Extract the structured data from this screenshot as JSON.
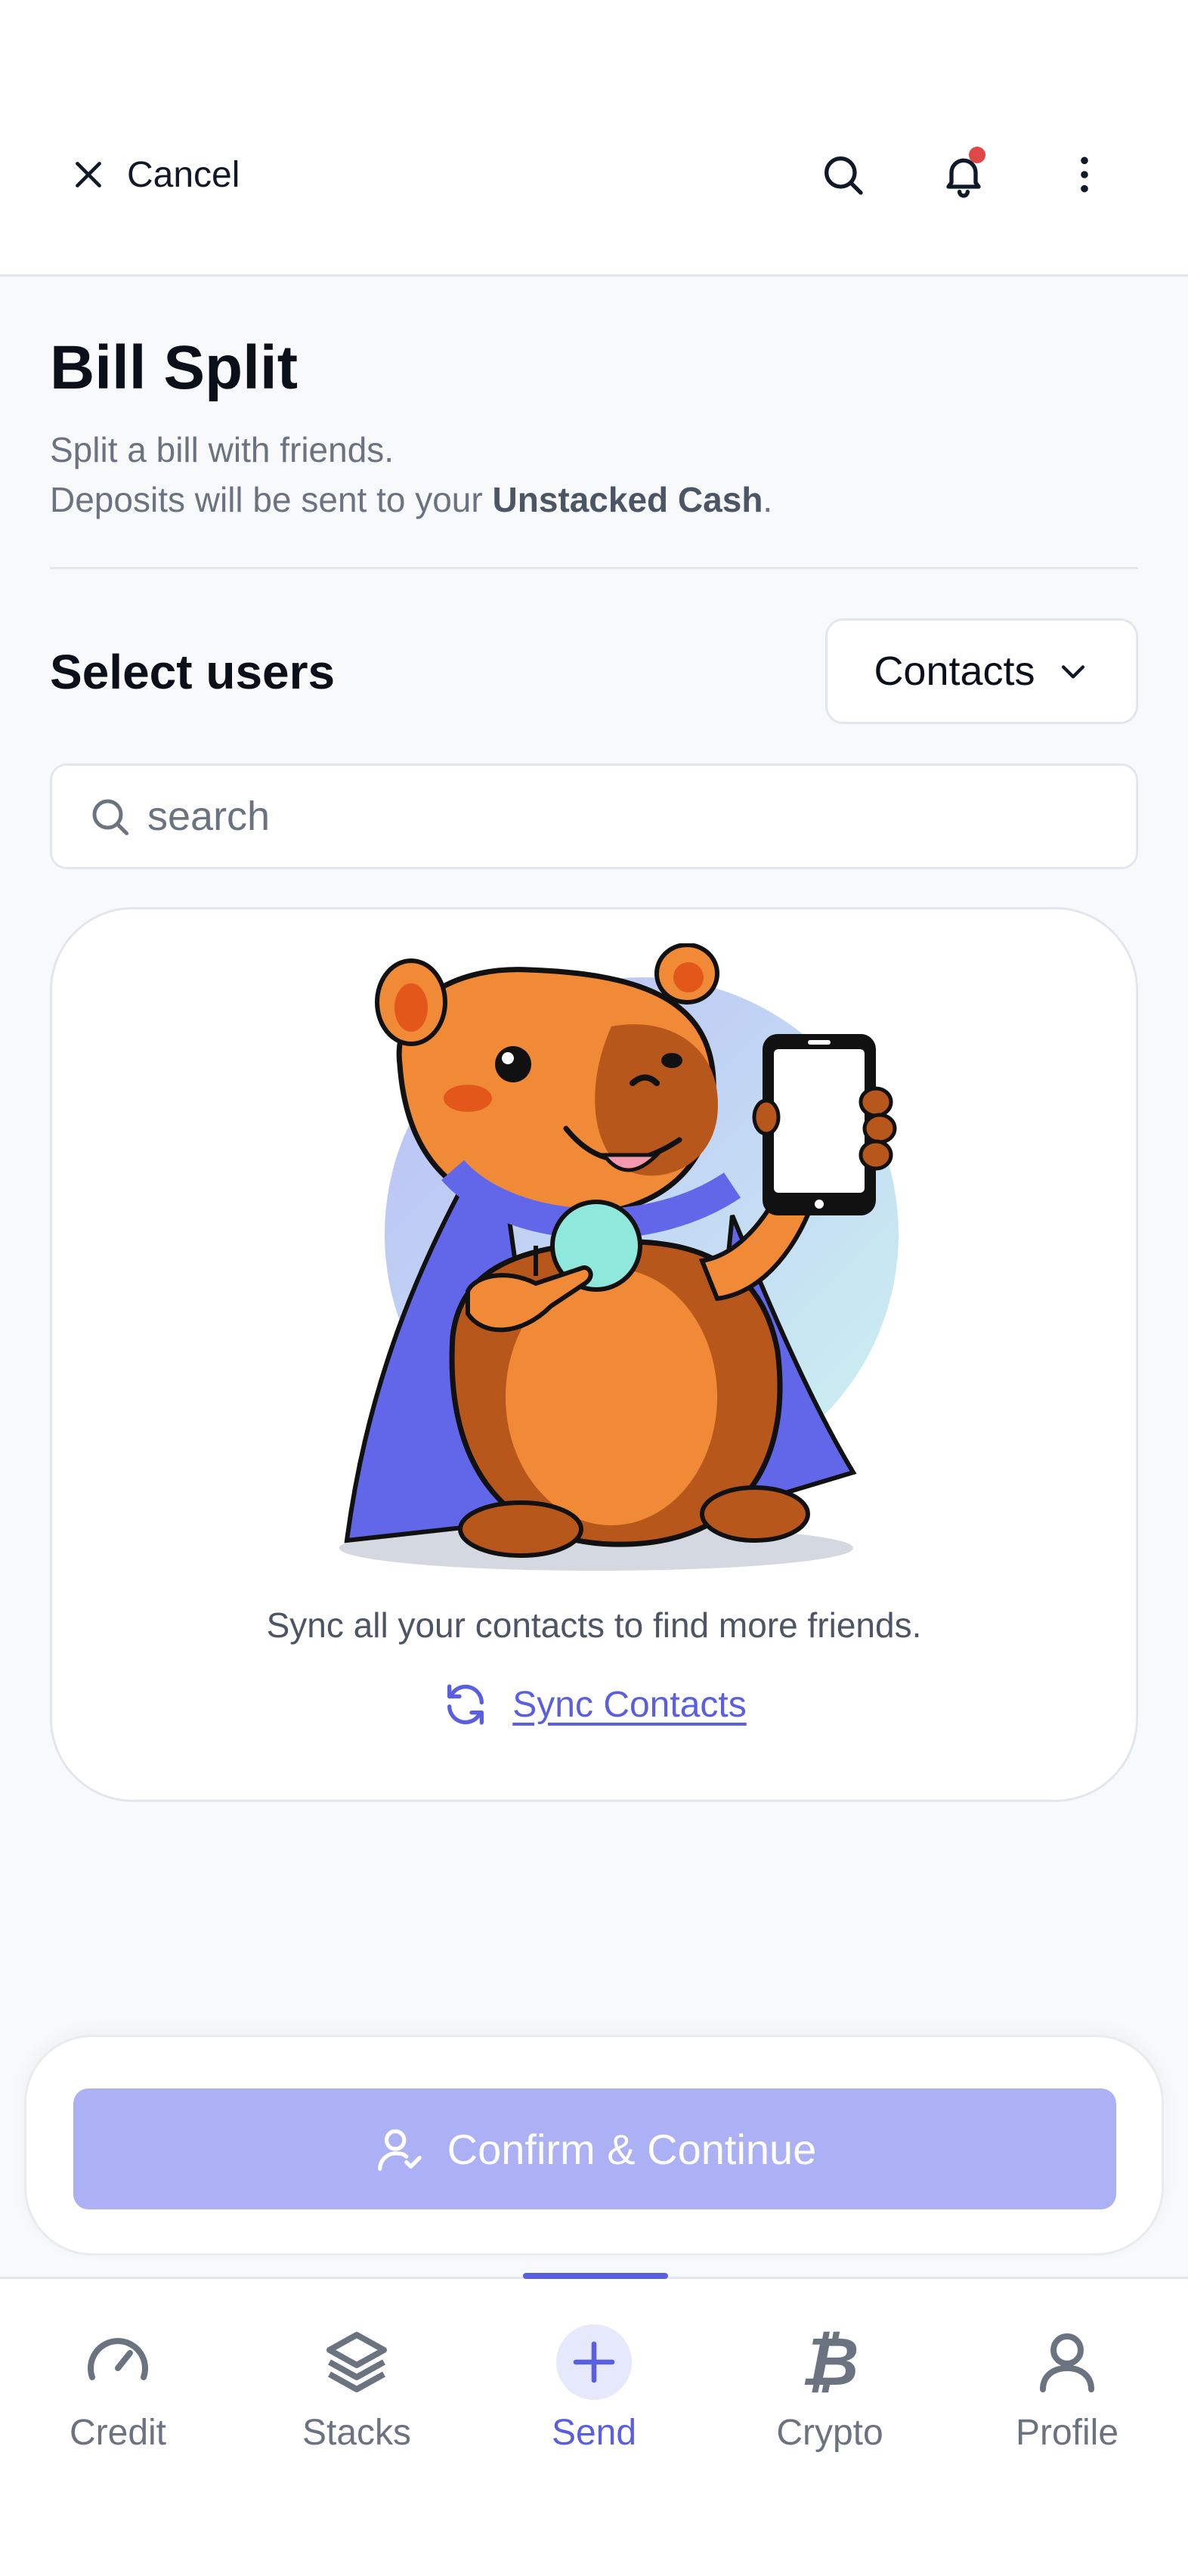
{
  "header": {
    "cancel_label": "Cancel",
    "icons": [
      "close-icon",
      "search-icon",
      "bell-icon",
      "more-vertical-icon"
    ],
    "notification_dot_color": "#e04848"
  },
  "page": {
    "title": "Bill Split",
    "subtitle_line1": "Split a bill with friends.",
    "subtitle_line2_prefix": "Deposits will be sent to your ",
    "subtitle_line2_bold": "Unstacked Cash",
    "subtitle_line2_suffix": "."
  },
  "select_users": {
    "title": "Select users",
    "dropdown_value": "Contacts",
    "search_placeholder": "search",
    "search_value": ""
  },
  "empty_state": {
    "message": "Sync all your contacts to find more friends.",
    "sync_label": "Sync Contacts"
  },
  "confirm": {
    "label": "Confirm & Continue",
    "bg_color": "#acb0f4"
  },
  "nav": {
    "items": [
      {
        "label": "Credit",
        "icon": "speedometer-icon"
      },
      {
        "label": "Stacks",
        "icon": "layers-icon"
      },
      {
        "label": "Send",
        "icon": "plus-icon",
        "active": true
      },
      {
        "label": "Crypto",
        "icon": "bitcoin-icon"
      },
      {
        "label": "Profile",
        "icon": "user-icon"
      }
    ]
  },
  "colors": {
    "accent": "#5a5fe0",
    "background": "#f8f9fb"
  }
}
